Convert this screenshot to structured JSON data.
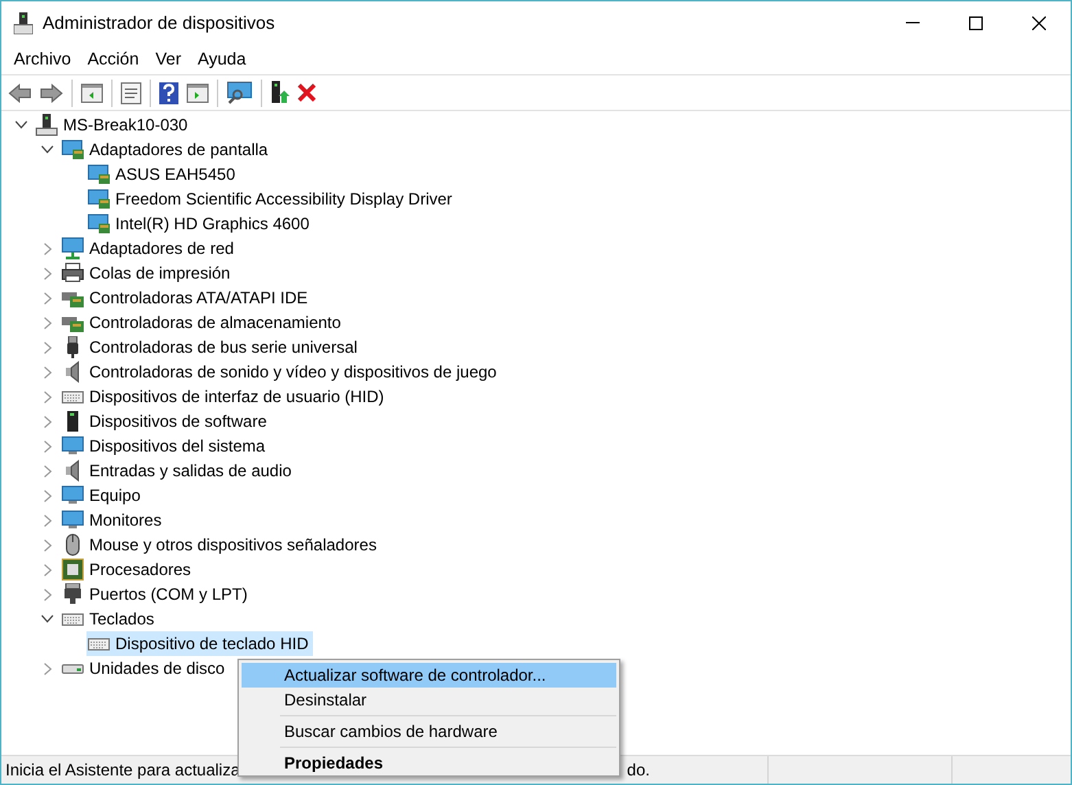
{
  "window": {
    "title": "Administrador de dispositivos"
  },
  "menu": [
    "Archivo",
    "Acción",
    "Ver",
    "Ayuda"
  ],
  "tree": [
    {
      "label": "MS-Break10-030",
      "kind": "computer",
      "expanded": true,
      "selected": false,
      "children": [
        {
          "label": "Adaptadores de pantalla",
          "kind": "display",
          "expanded": true,
          "selected": false,
          "children": [
            {
              "label": "ASUS EAH5450",
              "kind": "display",
              "selected": false
            },
            {
              "label": "Freedom Scientific Accessibility Display Driver",
              "kind": "display",
              "selected": false
            },
            {
              "label": "Intel(R) HD Graphics 4600",
              "kind": "display",
              "selected": false
            }
          ]
        },
        {
          "label": "Adaptadores de red",
          "kind": "network",
          "expanded": false,
          "selected": false
        },
        {
          "label": "Colas de impresión",
          "kind": "printer",
          "expanded": false,
          "selected": false
        },
        {
          "label": "Controladoras ATA/ATAPI IDE",
          "kind": "board",
          "expanded": false,
          "selected": false
        },
        {
          "label": "Controladoras de almacenamiento",
          "kind": "board",
          "expanded": false,
          "selected": false
        },
        {
          "label": "Controladoras de bus serie universal",
          "kind": "usb",
          "expanded": false,
          "selected": false
        },
        {
          "label": "Controladoras de sonido y vídeo y dispositivos de juego",
          "kind": "speaker",
          "expanded": false,
          "selected": false
        },
        {
          "label": "Dispositivos de interfaz de usuario (HID)",
          "kind": "keyboard",
          "expanded": false,
          "selected": false
        },
        {
          "label": "Dispositivos de software",
          "kind": "tower",
          "expanded": false,
          "selected": false
        },
        {
          "label": "Dispositivos del sistema",
          "kind": "monitor",
          "expanded": false,
          "selected": false
        },
        {
          "label": "Entradas y salidas de audio",
          "kind": "speaker",
          "expanded": false,
          "selected": false
        },
        {
          "label": "Equipo",
          "kind": "monitor",
          "expanded": false,
          "selected": false
        },
        {
          "label": "Monitores",
          "kind": "monitor",
          "expanded": false,
          "selected": false
        },
        {
          "label": "Mouse y otros dispositivos señaladores",
          "kind": "mouse",
          "expanded": false,
          "selected": false
        },
        {
          "label": "Procesadores",
          "kind": "chip",
          "expanded": false,
          "selected": false
        },
        {
          "label": "Puertos (COM y LPT)",
          "kind": "port",
          "expanded": false,
          "selected": false
        },
        {
          "label": "Teclados",
          "kind": "keyboard",
          "expanded": true,
          "selected": false,
          "children": [
            {
              "label": "Dispositivo de teclado HID",
              "kind": "keyboard",
              "selected": true
            }
          ]
        },
        {
          "label": "Unidades de disco",
          "kind": "disk",
          "expanded": false,
          "selected": false
        }
      ]
    }
  ],
  "context_menu": [
    {
      "kind": "item",
      "label": "Actualizar software de controlador...",
      "selected": true,
      "bold": false
    },
    {
      "kind": "item",
      "label": "Desinstalar",
      "selected": false,
      "bold": false
    },
    {
      "kind": "separator"
    },
    {
      "kind": "item",
      "label": "Buscar cambios de hardware",
      "selected": false,
      "bold": false
    },
    {
      "kind": "separator"
    },
    {
      "kind": "item",
      "label": "Propiedades",
      "selected": false,
      "bold": true
    }
  ],
  "status_bar": {
    "text_before": "Inicia el Asistente para actualiza",
    "text_after": "do."
  }
}
